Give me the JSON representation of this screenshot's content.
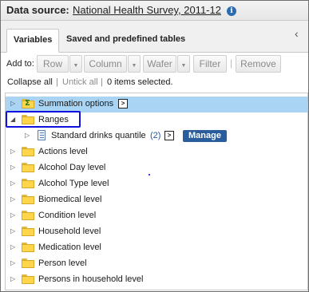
{
  "source": {
    "label": "Data source:",
    "name": "National Health Survey, 2011-12",
    "info_icon": "i"
  },
  "tabs": [
    {
      "label": "Variables",
      "active": true
    },
    {
      "label": "Saved and predefined tables",
      "active": false
    }
  ],
  "collapse_panel_icon": "‹",
  "toolbar": {
    "add_to_label": "Add to:",
    "row_label": "Row",
    "column_label": "Column",
    "wafer_label": "Wafer",
    "filter_label": "Filter",
    "remove_label": "Remove",
    "dropdown_glyph": "▼",
    "separator": "|"
  },
  "options": {
    "collapse_all": "Collapse all",
    "separator": "|",
    "untick_all": "Untick all",
    "items_selected": "0 items selected."
  },
  "tree": {
    "expanded_glyph": "◢",
    "collapsed_glyph": "▷",
    "more_glyph": ">",
    "summation": {
      "label": "Summation options",
      "sigma": "Σ"
    },
    "ranges": {
      "label": "Ranges"
    },
    "standard_drinks": {
      "label": "Standard drinks quantile",
      "count": "(2)",
      "manage_label": "Manage"
    },
    "folders": [
      "Actions level",
      "Alcohol Day level",
      "Alcohol Type level",
      "Biomedical level",
      "Condition level",
      "Household level",
      "Medication level",
      "Person level",
      "Persons in household level"
    ]
  },
  "colors": {
    "selected_row": "#a9d4f3",
    "manage_button": "#2a5d9b",
    "highlight_border": "#1111dd",
    "folder_yellow": "#ffd54a"
  }
}
